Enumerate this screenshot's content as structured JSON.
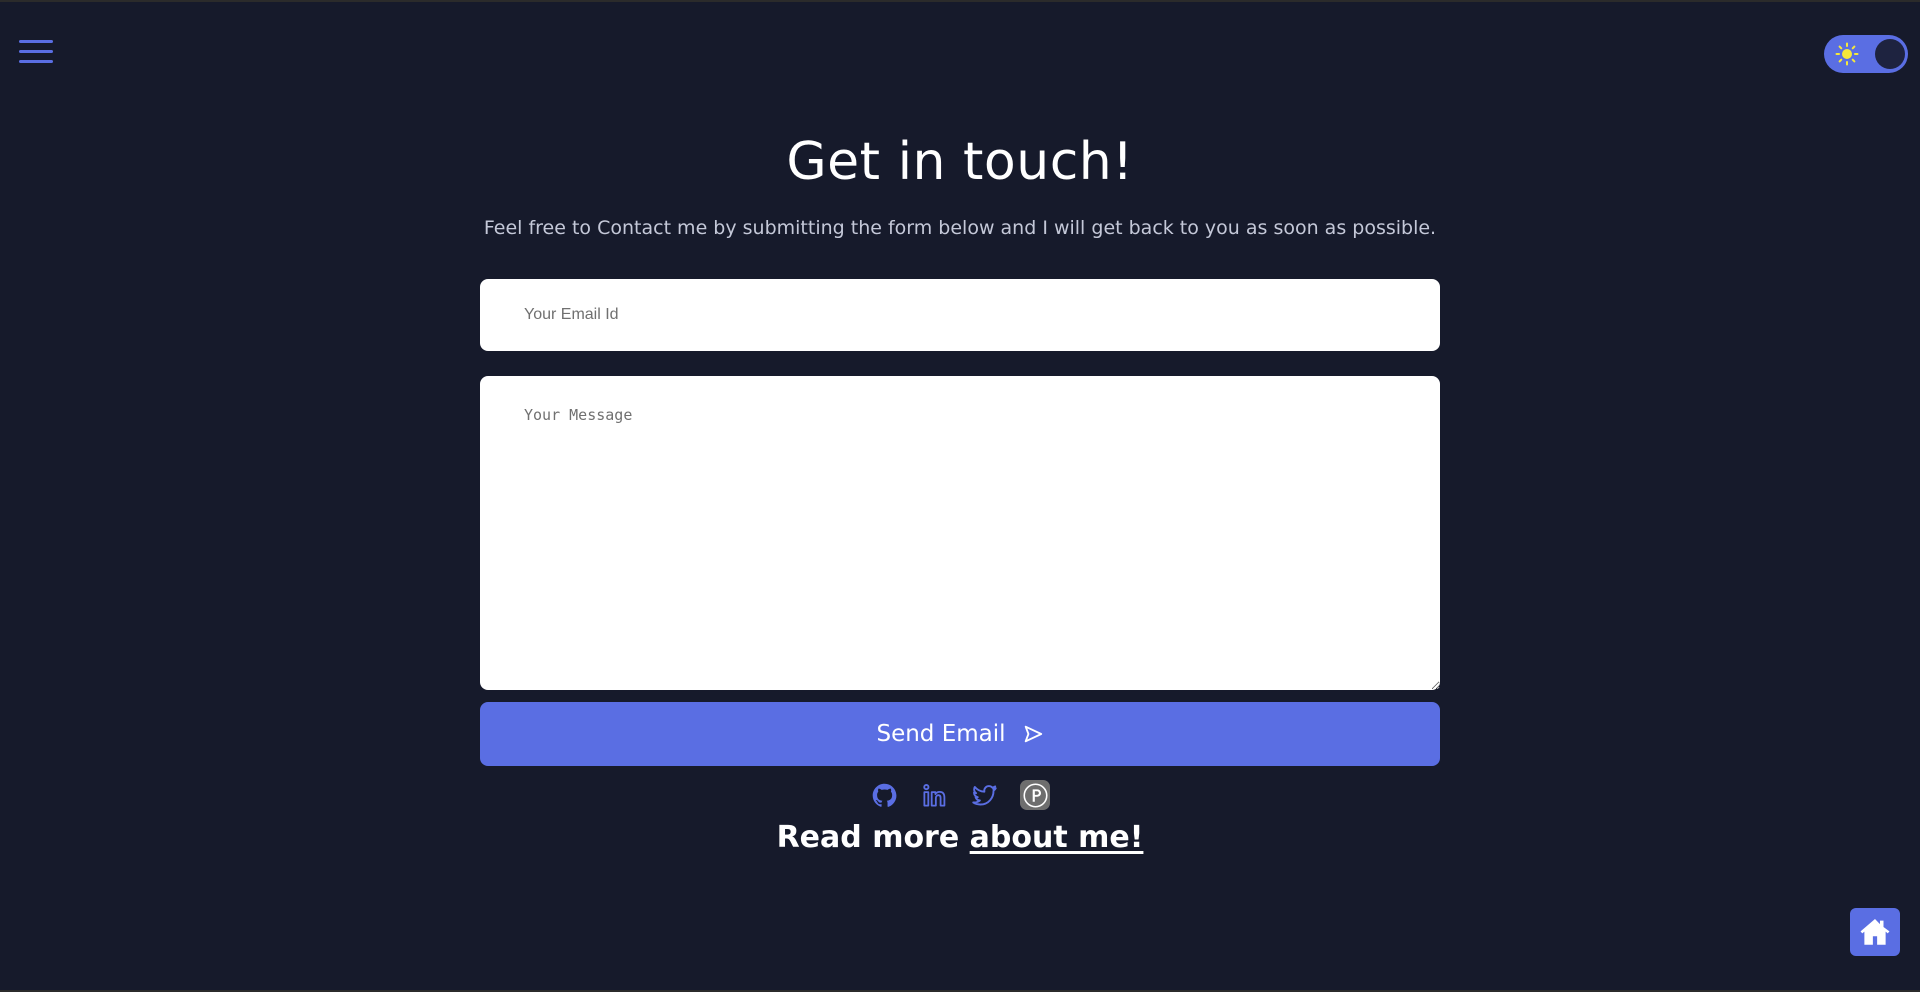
{
  "nav": {
    "menu_icon": "hamburger-menu-icon"
  },
  "theme_toggle": {
    "icon": "sun-icon",
    "state": "dark"
  },
  "contact": {
    "heading": "Get in touch!",
    "subtext": "Feel free to Contact me by submitting the form below and I will get back to you as soon as possible.",
    "email_placeholder": "Your Email Id",
    "email_value": "",
    "message_placeholder": "Your Message",
    "message_value": "",
    "send_label": "Send Email",
    "send_icon": "send-arrow-icon"
  },
  "socials": [
    {
      "name": "github",
      "icon": "github-icon"
    },
    {
      "name": "linkedin",
      "icon": "linkedin-icon"
    },
    {
      "name": "twitter",
      "icon": "twitter-icon"
    },
    {
      "name": "producthunt",
      "icon": "producthunt-icon"
    }
  ],
  "read_more": {
    "prefix": "Read more ",
    "link_text": "about me!"
  },
  "home_button": {
    "icon": "home-icon"
  },
  "colors": {
    "background": "#161a2b",
    "accent": "#5a6ee3",
    "text": "#ffffff",
    "subtext": "#c4c8d8"
  }
}
